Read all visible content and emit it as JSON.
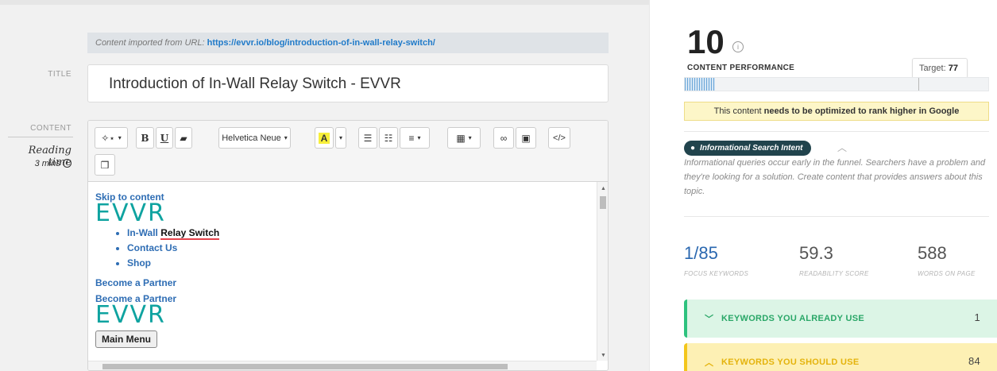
{
  "editor": {
    "import_text": "Content imported from URL:",
    "import_url": "https://evvr.io/blog/introduction-of-in-wall-relay-switch/",
    "title_label": "TITLE",
    "title_value": "Introduction of In-Wall Relay Switch - EVVR",
    "content_label": "CONTENT",
    "reading_time_label": "Reading time",
    "reading_time_value": "3 mins",
    "toolbar": {
      "magic_label": "✧⋆",
      "bold_label": "B",
      "underline_label": "U",
      "eraser_label": "▰",
      "font_label": "Helvetica Neue",
      "highlight_label": "A",
      "ul_label": "☰",
      "ol_label": "☷",
      "align_label": "≡",
      "table_label": "▦",
      "link_label": "∞",
      "image_label": "▣",
      "code_label": "</>",
      "clear_label": "❒"
    },
    "content": {
      "skip_link": "Skip to content",
      "logo_text": "EVVR",
      "nav_items": [
        "In-Wall",
        "Relay Switch",
        "Contact Us",
        "Shop"
      ],
      "partner_1": "Become a Partner",
      "partner_2": "Become a Partner",
      "logo_text_2": "EVVR",
      "main_menu": "Main Menu"
    }
  },
  "panel": {
    "score": "10",
    "content_performance_label": "CONTENT PERFORMANCE",
    "target_label": "Target:",
    "target_value": "77",
    "performance_value": 10,
    "target_fraction": 77,
    "warning_prefix": "This content",
    "warning_bold": "needs to be optimized to rank higher in Google",
    "intent_badge": "Informational Search Intent",
    "intent_description": "Informational queries occur early in the funnel. Searchers have a problem and they're looking for a solution. Create content that provides answers about this topic.",
    "metrics": [
      {
        "value": "1/85",
        "label": "FOCUS KEYWORDS"
      },
      {
        "value": "59.3",
        "label": "READABILITY SCORE"
      },
      {
        "value": "588",
        "label": "WORDS ON PAGE"
      }
    ],
    "keywords_use": {
      "label": "KEYWORDS YOU ALREADY USE",
      "count": "1"
    },
    "keywords_should": {
      "label": "KEYWORDS YOU SHOULD USE",
      "count": "84"
    }
  },
  "colors": {
    "accent_blue": "#2b68b0",
    "evvr_teal": "#0fa3a0",
    "green": "#2ec27e",
    "yellow": "#f3c61c",
    "badge_dark": "#21444d"
  }
}
